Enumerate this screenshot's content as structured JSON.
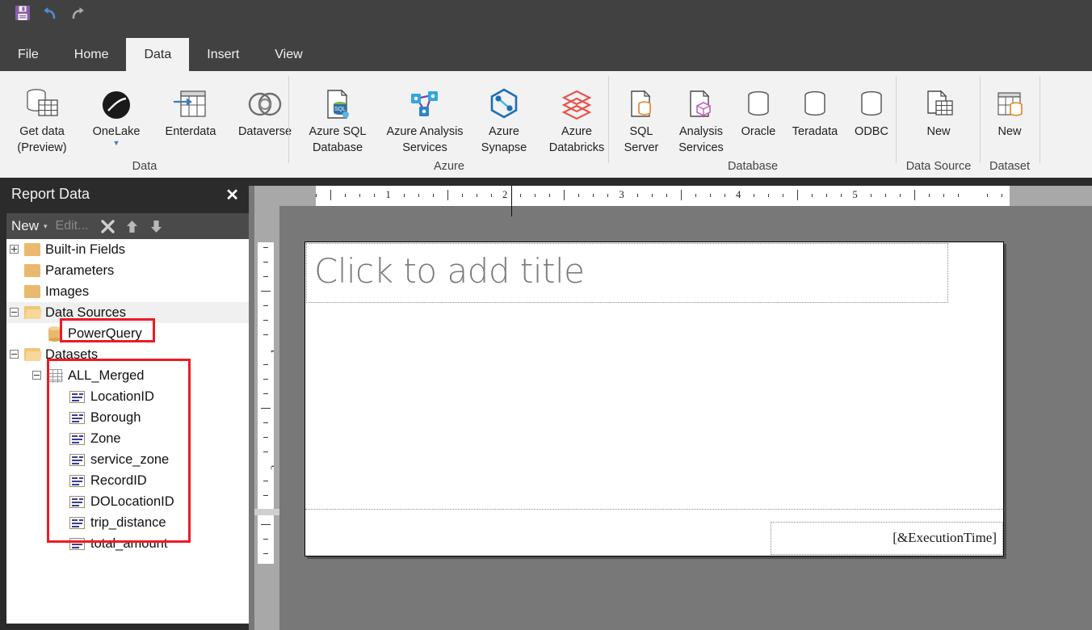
{
  "app": {
    "quick_access": [
      {
        "name": "save-icon",
        "label": "Save"
      },
      {
        "name": "undo-icon",
        "label": "Undo"
      },
      {
        "name": "redo-icon",
        "label": "Redo"
      }
    ]
  },
  "ribbon": {
    "tabs": [
      {
        "label": "File",
        "active": false
      },
      {
        "label": "Home",
        "active": false
      },
      {
        "label": "Data",
        "active": true
      },
      {
        "label": "Insert",
        "active": false
      },
      {
        "label": "View",
        "active": false
      }
    ],
    "groups": [
      {
        "title": "Data",
        "items": [
          {
            "label": "Get data\n(Preview)",
            "line1": "Get data",
            "line2": "(Preview)",
            "icon": "get-data-icon",
            "caret": false
          },
          {
            "label": "OneLake",
            "line1": "OneLake",
            "line2": "",
            "icon": "onelake-icon",
            "caret": true
          },
          {
            "label": "Enterdata",
            "line1": "Enterdata",
            "line2": "",
            "icon": "enter-data-icon",
            "caret": false
          },
          {
            "label": "Dataverse",
            "line1": "Dataverse",
            "line2": "",
            "icon": "dataverse-icon",
            "caret": false
          }
        ]
      },
      {
        "title": "Azure",
        "items": [
          {
            "line1": "Azure SQL",
            "line2": "Database",
            "icon": "azure-sql-database-icon",
            "caret": false
          },
          {
            "line1": "Azure Analysis",
            "line2": "Services",
            "icon": "azure-analysis-services-icon",
            "caret": false
          },
          {
            "line1": "Azure",
            "line2": "Synapse",
            "icon": "azure-synapse-icon",
            "caret": false
          },
          {
            "line1": "Azure",
            "line2": "Databricks",
            "icon": "azure-databricks-icon",
            "caret": false
          }
        ]
      },
      {
        "title": "Database",
        "items": [
          {
            "line1": "SQL",
            "line2": "Server",
            "icon": "sql-server-icon",
            "caret": false
          },
          {
            "line1": "Analysis",
            "line2": "Services",
            "icon": "analysis-services-icon",
            "caret": false
          },
          {
            "line1": "Oracle",
            "line2": "",
            "icon": "oracle-icon",
            "caret": false
          },
          {
            "line1": "Teradata",
            "line2": "",
            "icon": "teradata-icon",
            "caret": false
          },
          {
            "line1": "ODBC",
            "line2": "",
            "icon": "odbc-icon",
            "caret": false
          }
        ]
      },
      {
        "title": "Data Source",
        "items": [
          {
            "line1": "New",
            "line2": "",
            "icon": "new-data-source-icon",
            "caret": false
          }
        ]
      },
      {
        "title": "Dataset",
        "items": [
          {
            "line1": "New",
            "line2": "",
            "icon": "new-dataset-icon",
            "caret": false
          }
        ]
      }
    ]
  },
  "report_data_pane": {
    "title": "Report Data",
    "close_label": "✕",
    "toolbar": {
      "new_label": "New",
      "new_caret": "▾",
      "edit_label": "Edit...",
      "delete_label": "✕",
      "move_up_label": "Move Up",
      "move_down_label": "Move Down"
    },
    "tree": [
      {
        "label": "Built-in Fields",
        "icon": "folder-icon",
        "expander": "plus",
        "indent": 0
      },
      {
        "label": "Parameters",
        "icon": "folder-icon",
        "expander": "none",
        "indent": 0
      },
      {
        "label": "Images",
        "icon": "folder-icon",
        "expander": "none",
        "indent": 0
      },
      {
        "label": "Data Sources",
        "icon": "folder-open-icon",
        "expander": "minus",
        "indent": 0,
        "selected": true
      },
      {
        "label": "PowerQuery",
        "icon": "data-source-icon",
        "expander": "none",
        "indent": 1,
        "highlighted": true
      },
      {
        "label": "Datasets",
        "icon": "folder-open-icon",
        "expander": "minus",
        "indent": 0
      },
      {
        "label": "ALL_Merged",
        "icon": "dataset-icon",
        "expander": "minus",
        "indent": 1
      },
      {
        "label": "LocationID",
        "icon": "field-icon",
        "expander": "none",
        "indent": 2
      },
      {
        "label": "Borough",
        "icon": "field-icon",
        "expander": "none",
        "indent": 2
      },
      {
        "label": "Zone",
        "icon": "field-icon",
        "expander": "none",
        "indent": 2
      },
      {
        "label": "service_zone",
        "icon": "field-icon",
        "expander": "none",
        "indent": 2
      },
      {
        "label": "RecordID",
        "icon": "field-icon",
        "expander": "none",
        "indent": 2
      },
      {
        "label": "DOLocationID",
        "icon": "field-icon",
        "expander": "none",
        "indent": 2
      },
      {
        "label": "trip_distance",
        "icon": "field-icon",
        "expander": "none",
        "indent": 2
      },
      {
        "label": "total_amount",
        "icon": "field-icon",
        "expander": "none",
        "indent": 2
      }
    ]
  },
  "design_surface": {
    "horizontal_ruler_labels": [
      "1",
      "2",
      "3",
      "4",
      "5"
    ],
    "vertical_ruler_labels": [
      "1",
      "2"
    ],
    "title_placeholder": "Click to add title",
    "footer_expression": "[&ExecutionTime]"
  },
  "colors": {
    "chrome_dark": "#414141",
    "pane_dark": "#2b2b2b",
    "ribbon_bg": "#f2f2f2",
    "canvas_gray": "#787878",
    "ruler_gray": "#a8a8a8",
    "highlight_red": "#ee1b24",
    "accent_blue": "#3a7ebd",
    "save_purple": "#8b5ea8"
  }
}
